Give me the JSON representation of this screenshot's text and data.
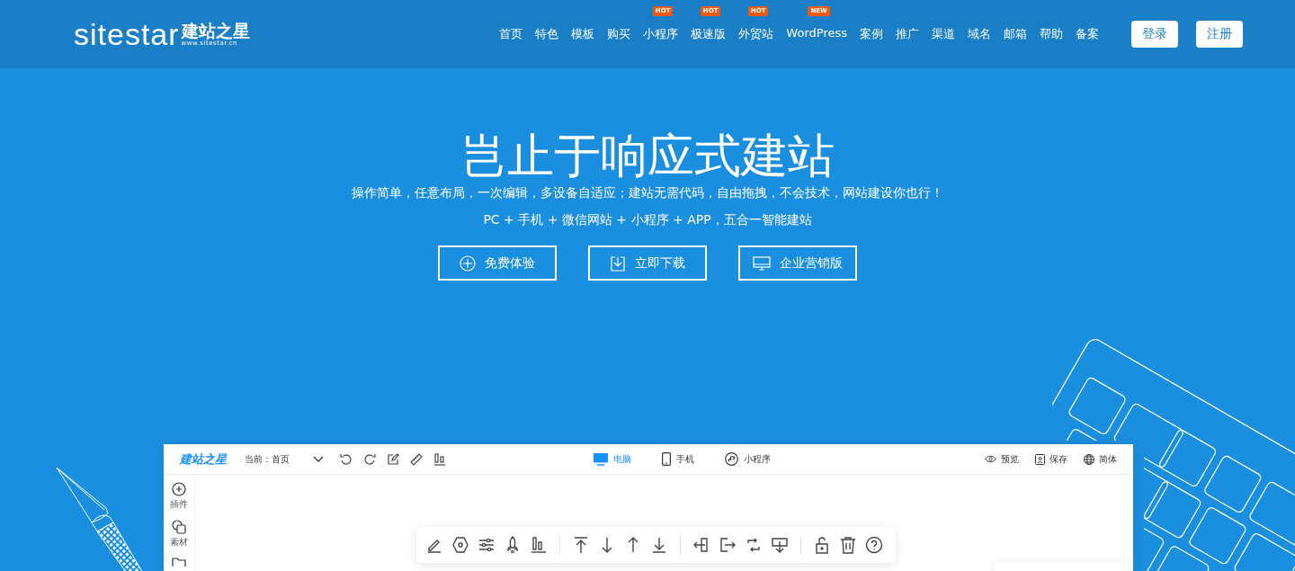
{
  "header": {
    "logo": {
      "wordmark": "sitestar",
      "name": "建站之星",
      "url": "www.sitestar.cn"
    },
    "nav": [
      {
        "label": "首页"
      },
      {
        "label": "特色"
      },
      {
        "label": "模板"
      },
      {
        "label": "购买"
      },
      {
        "label": "小程序",
        "badge": "HOT"
      },
      {
        "label": "极速版",
        "badge": "HOT"
      },
      {
        "label": "外贸站",
        "badge": "HOT"
      },
      {
        "label": "WordPress",
        "badge": "NEW"
      },
      {
        "label": "案例"
      },
      {
        "label": "推广"
      },
      {
        "label": "渠道"
      },
      {
        "label": "域名"
      },
      {
        "label": "邮箱"
      },
      {
        "label": "帮助"
      },
      {
        "label": "备案"
      }
    ],
    "buttons": [
      "登录",
      "注册"
    ]
  },
  "hero": {
    "title": "岂止于响应式建站",
    "subtitle": "操作简单，任意布局，一次编辑，多设备自适应；建站无需代码，自由拖拽，不会技术，网站建设你也行！",
    "tagline": "PC + 手机 + 微信网站 + 小程序 + APP，五合一智能建站",
    "actions": [
      {
        "label": "免费体验",
        "kind": "plus"
      },
      {
        "label": "立即下载",
        "kind": "download"
      },
      {
        "label": "企业营销版",
        "kind": "monitor"
      }
    ]
  },
  "editor": {
    "brand": "建站之星",
    "current_page": "当前：首页",
    "devices": [
      {
        "label": "电脑",
        "kind": "desktop",
        "selected": true
      },
      {
        "label": "手机",
        "kind": "mobile",
        "selected": false
      },
      {
        "label": "小程序",
        "kind": "miniapp",
        "selected": false
      }
    ],
    "actions": [
      {
        "label": "预览",
        "kind": "eye"
      },
      {
        "label": "保存",
        "kind": "save"
      },
      {
        "label": "简体",
        "kind": "globe"
      }
    ],
    "sidebar": [
      {
        "label": "插件",
        "kind": "plus"
      },
      {
        "label": "素材",
        "kind": "shapes"
      },
      {
        "kind": "folder"
      }
    ]
  }
}
